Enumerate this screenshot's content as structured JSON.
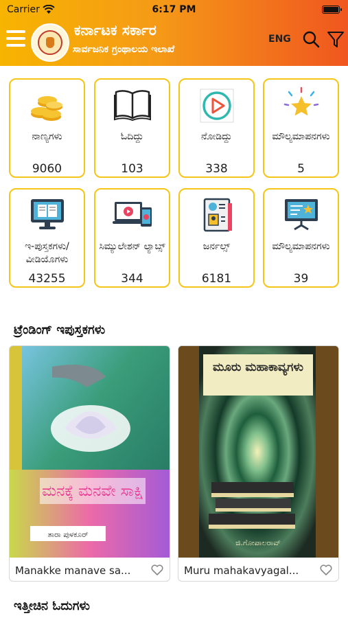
{
  "status": {
    "carrier": "Carrier",
    "time": "6:17 PM"
  },
  "header": {
    "title": "ಕರ್ನಾಟಕ ಸರ್ಕಾರ",
    "subtitle": "ಸಾರ್ವಜನಿಕ ಗ್ರಂಥಾಲಯ ಇಲಾಖೆ",
    "language": "ENG",
    "colors": {
      "gradient_start": "#f7b400",
      "gradient_end": "#f0561f"
    }
  },
  "tiles": [
    {
      "label": "ನಾಣ್ಯಗಳು",
      "count": "9060",
      "icon": "coins-icon"
    },
    {
      "label": "ಓದಿದ್ದು",
      "count": "103",
      "icon": "open-book-icon"
    },
    {
      "label": "ನೋಡಿದ್ದು",
      "count": "338",
      "icon": "play-icon"
    },
    {
      "label": "ಮೌಲ್ಯಮಾಪನಗಳು",
      "count": "5",
      "icon": "star-icon"
    },
    {
      "label": "ಇ-ಪುಸ್ತಕಗಳು/ ವೀಡಿಯೊಗಳು",
      "count": "43255",
      "icon": "ebook-monitor-icon"
    },
    {
      "label": "ಸಿಮ್ಯುಲೇಶನ್ ಲ್ಯಾಬ್ಸ್",
      "count": "344",
      "icon": "devices-icon"
    },
    {
      "label": "ಜರ್ನಲ್ಸ್",
      "count": "6181",
      "icon": "journal-icon"
    },
    {
      "label": "ಮೌಲ್ಯಮಾಪನಗಳು",
      "count": "39",
      "icon": "presentation-icon"
    }
  ],
  "trending": {
    "title": "ಟ್ರೆಂಡಿಂಗ್ ಇಪುಸ್ತಕಗಳು",
    "books": [
      {
        "title": "Manakke manave sa...",
        "cover_text": "ಮನಕ್ಕೆ ಮನವೇ ಸಾಕ್ಷಿ",
        "author": "ತಾರಾ ಪುಳಕೂರ್"
      },
      {
        "title": "Muru mahakavyagal...",
        "cover_text": "ಮೂರು ಮಹಾಕಾವ್ಯಗಳು",
        "author": "ಜಿ.ಗೋಪಾಲರಾವ್"
      }
    ]
  },
  "recent": {
    "title": "ಇತ್ತೀಚಿನ ಓದುಗಳು"
  },
  "colors": {
    "tile_border": "#f5c518"
  }
}
